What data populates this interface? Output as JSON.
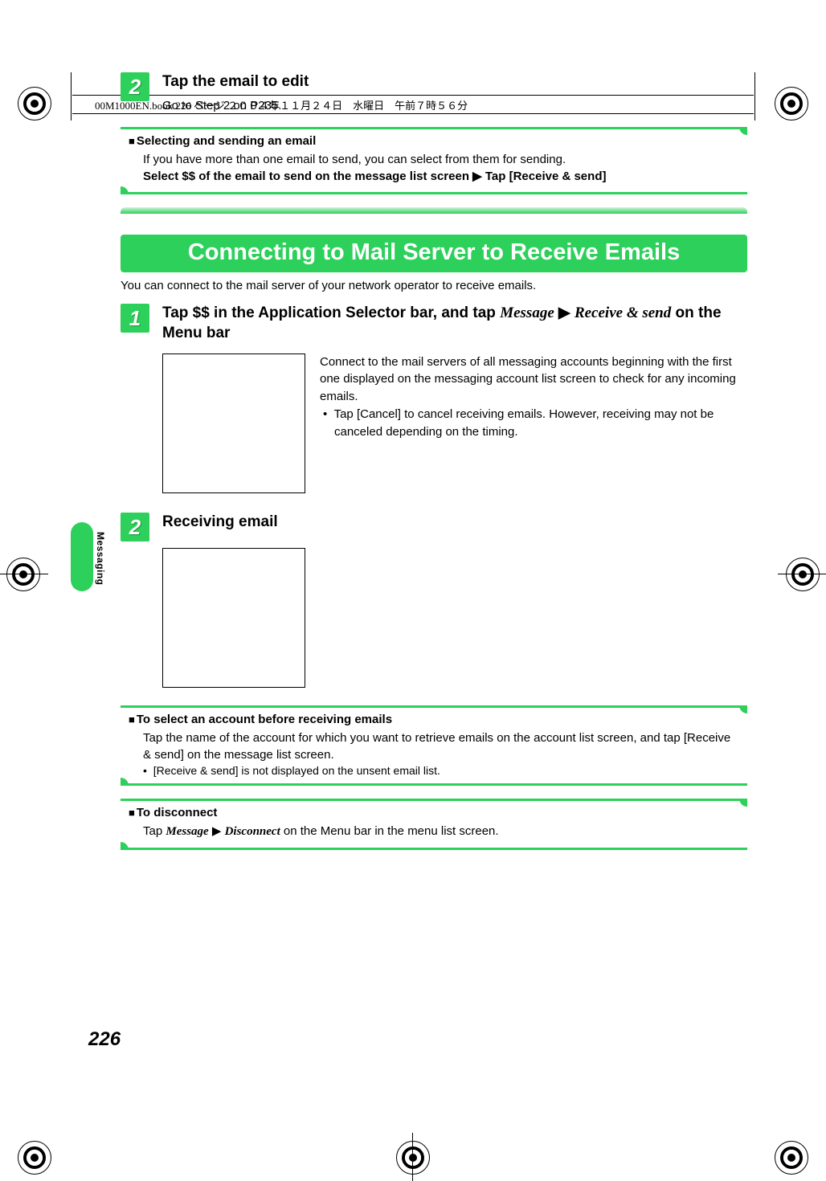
{
  "print_header": "00M1000EN.book  226 ページ  ２００４年１１月２４日　水曜日　午前７時５６分",
  "side_tab_label": "Messaging",
  "page_number": "226",
  "step2_top": {
    "num": "2",
    "title": "Tap the email to edit",
    "text": "Go to Step 2 on P235."
  },
  "note1": {
    "title": "Selecting and sending an email",
    "body": "If you have more than one email to send, you can select from them for sending.",
    "bold_line_prefix": "Select $$ of the email to send on the message list screen ",
    "bold_line_suffix": " Tap [Receive & send]"
  },
  "banner": "Connecting to Mail Server to Receive Emails",
  "intro": "You can connect to the mail server of your network operator to receive emails.",
  "step1": {
    "num": "1",
    "title_prefix": "Tap $$ in the Application Selector bar, and tap ",
    "title_ref1": "Message",
    "title_mid": " ",
    "title_ref2": "Receive & send",
    "title_suffix": " on the Menu bar",
    "info1": "Connect to the mail servers of all messaging accounts beginning with the first one displayed on the messaging account list screen to check for any incoming emails.",
    "info2": "Tap [Cancel] to cancel receiving emails. However, receiving may not be canceled depending on the timing."
  },
  "step2_recv": {
    "num": "2",
    "title": "Receiving email"
  },
  "note2": {
    "title": "To select an account before receiving emails",
    "body": "Tap the name of the account for which you want to retrieve emails on the account list screen, and tap [Receive & send] on the message list screen.",
    "bullet": "[Receive & send] is not displayed on the unsent email list."
  },
  "note3": {
    "title": "To disconnect",
    "body_prefix": "Tap ",
    "body_ref1": "Message",
    "body_mid": " ",
    "body_ref2": "Disconnect",
    "body_suffix": " on the Menu bar in the menu list screen."
  },
  "arrow": "▶"
}
